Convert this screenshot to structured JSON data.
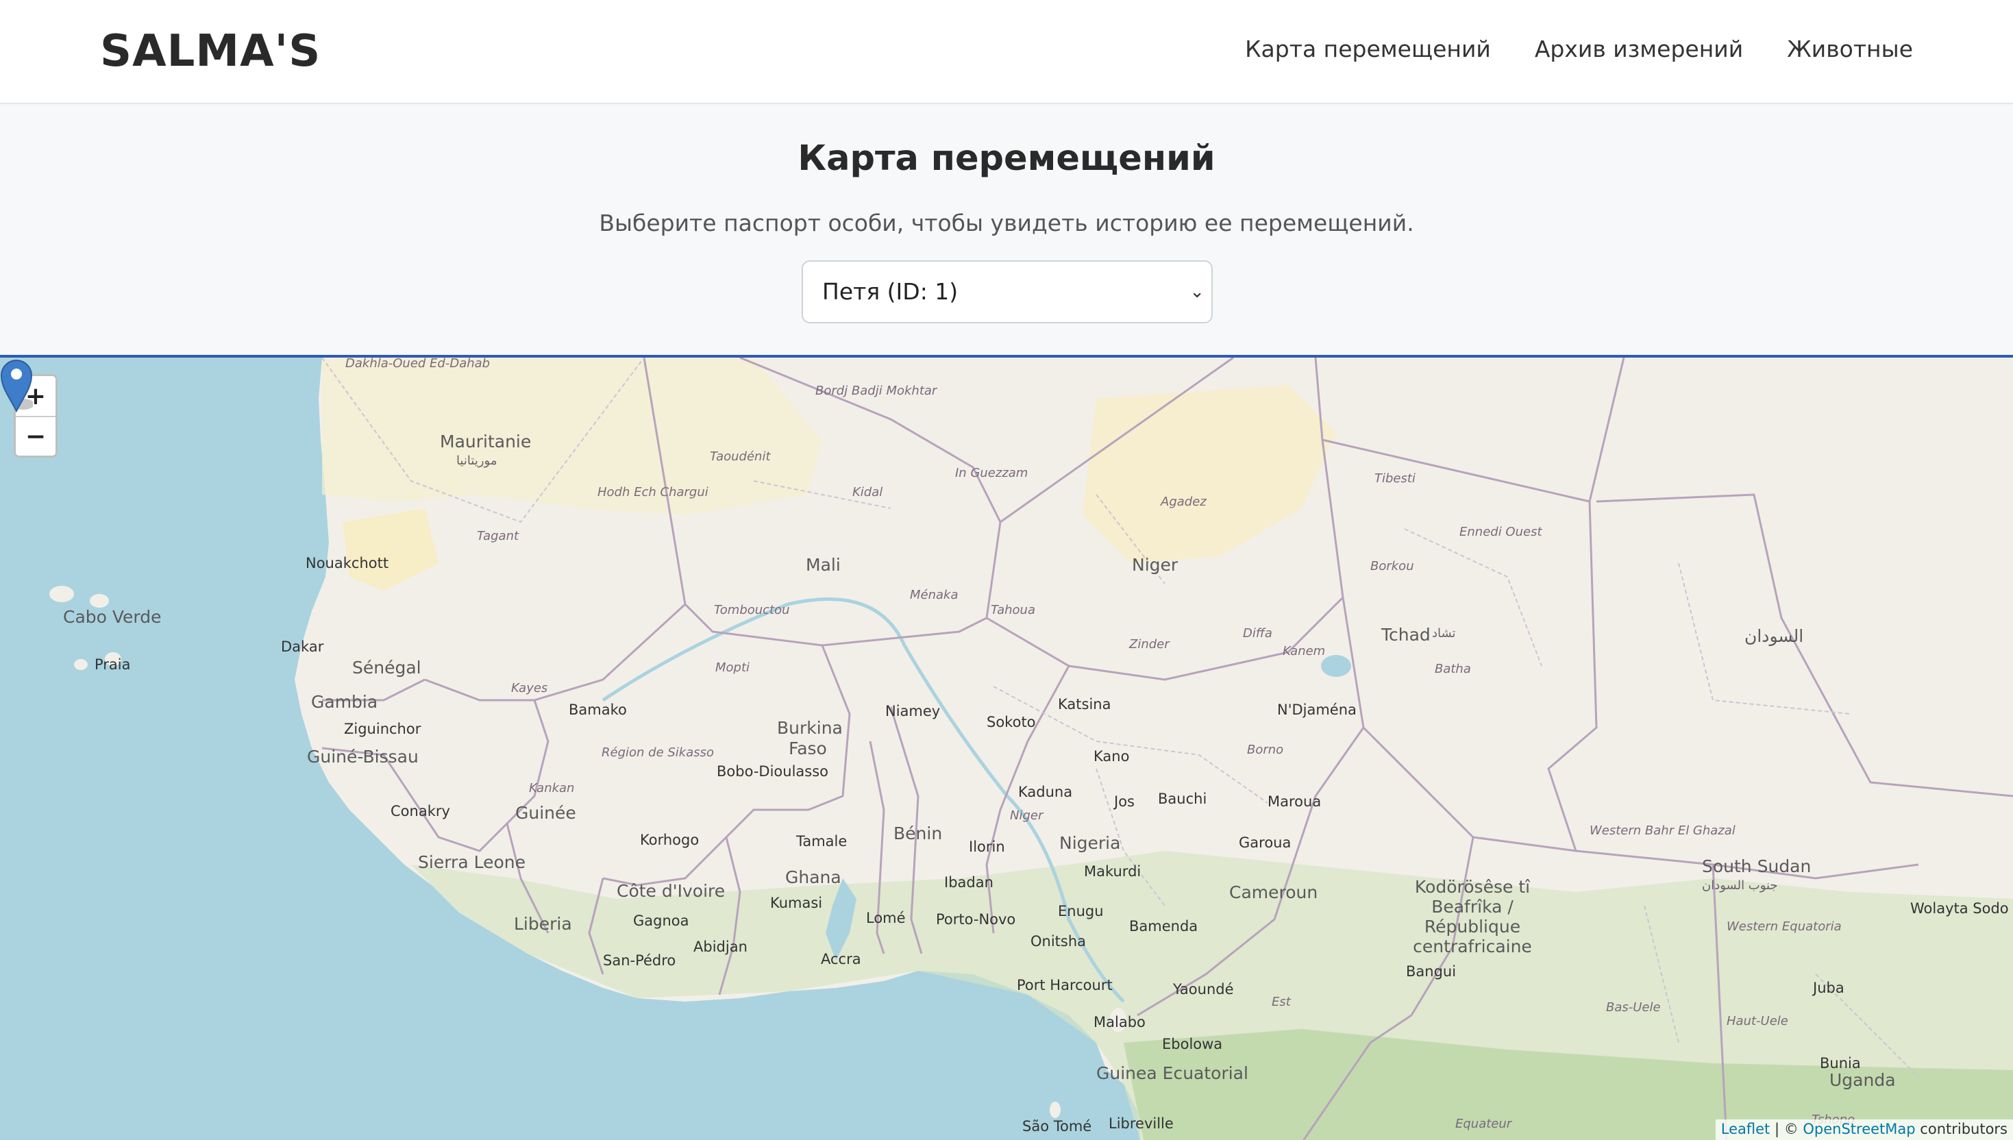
{
  "header": {
    "logo": "SALMA'S",
    "nav": [
      "Карта перемещений",
      "Архив измерений",
      "Животные"
    ]
  },
  "intro": {
    "title": "Карта перемещений",
    "subtitle": "Выберите паспорт особи, чтобы увидеть историю ее перемещений.",
    "selected_animal": "Петя (ID: 1)"
  },
  "map": {
    "zoom_in": "+",
    "zoom_out": "−",
    "attribution": {
      "leaflet": "Leaflet",
      "separator": "| ©",
      "osm": "OpenStreetMap",
      "suffix": "contributors"
    },
    "labels": {
      "countries": [
        "Mauritanie",
        "Mali",
        "Niger",
        "Tchad",
        "Sénégal",
        "Gambia",
        "Guiné-Bissau",
        "Guinée",
        "Sierra Leone",
        "Liberia",
        "Côte d'Ivoire",
        "Burkina Faso",
        "Ghana",
        "Bénin",
        "Nigeria",
        "Cameroun",
        "Kodörösêse tî Beafrîka / République centrafricaine",
        "South Sudan",
        "Guinea Ecuatorial",
        "Cabo Verde",
        "Uganda"
      ],
      "arabic": [
        "موريتانيا",
        "تشاد",
        "السودان",
        "جنوب السودان"
      ],
      "cities": [
        "Nouakchott",
        "Dakar",
        "Praia",
        "Bamako",
        "Niamey",
        "Ziguinchor",
        "Conakry",
        "Bobo-Dioulasso",
        "Sokoto",
        "Katsina",
        "Kano",
        "N'Djaména",
        "Kaduna",
        "Jos",
        "Bauchi",
        "Maroua",
        "Garoua",
        "Korhogo",
        "Tamale",
        "Ilorin",
        "Makurdi",
        "Kumasi",
        "Ibadan",
        "Gagnoa",
        "Abidjan",
        "Lomé",
        "Porto-Novo",
        "Accra",
        "San-Pédro",
        "Enugu",
        "Bamenda",
        "Onitsha",
        "Port Harcourt",
        "Yaoundé",
        "Malabo",
        "Ebolowa",
        "São Tomé",
        "Libreville",
        "Bangui",
        "Juba",
        "Bunia",
        "Wolayta Sodo"
      ],
      "regions": [
        "Dakhla-Oued Ed-Dahab",
        "Taoudénit",
        "Bordj Badji Mokhtar",
        "Hodh Ech Chargui",
        "Kidal",
        "In Guezzam",
        "Agadez",
        "Tibesti",
        "Tagant",
        "Ménaka",
        "Tahoua",
        "Tombouctou",
        "Borkou",
        "Ennedi Ouest",
        "Mopti",
        "Kayes",
        "Zinder",
        "Diffa",
        "Kanem",
        "Batha",
        "Région de Sikasso",
        "Kankan",
        "Borno",
        "Niger",
        "Western Bahr El Ghazal",
        "Western Equatoria",
        "Bas-Uele",
        "Haut-Uele",
        "Est",
        "Tshopo",
        "Equateur"
      ]
    },
    "marker_icon": "map-marker-icon"
  }
}
